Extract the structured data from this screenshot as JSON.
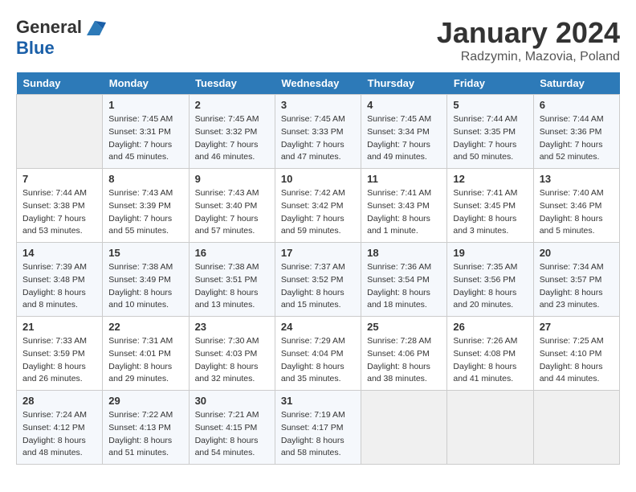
{
  "header": {
    "logo_general": "General",
    "logo_blue": "Blue",
    "month": "January 2024",
    "location": "Radzymin, Mazovia, Poland"
  },
  "weekdays": [
    "Sunday",
    "Monday",
    "Tuesday",
    "Wednesday",
    "Thursday",
    "Friday",
    "Saturday"
  ],
  "weeks": [
    [
      {
        "day": "",
        "sunrise": "",
        "sunset": "",
        "daylight": ""
      },
      {
        "day": "1",
        "sunrise": "Sunrise: 7:45 AM",
        "sunset": "Sunset: 3:31 PM",
        "daylight": "Daylight: 7 hours and 45 minutes."
      },
      {
        "day": "2",
        "sunrise": "Sunrise: 7:45 AM",
        "sunset": "Sunset: 3:32 PM",
        "daylight": "Daylight: 7 hours and 46 minutes."
      },
      {
        "day": "3",
        "sunrise": "Sunrise: 7:45 AM",
        "sunset": "Sunset: 3:33 PM",
        "daylight": "Daylight: 7 hours and 47 minutes."
      },
      {
        "day": "4",
        "sunrise": "Sunrise: 7:45 AM",
        "sunset": "Sunset: 3:34 PM",
        "daylight": "Daylight: 7 hours and 49 minutes."
      },
      {
        "day": "5",
        "sunrise": "Sunrise: 7:44 AM",
        "sunset": "Sunset: 3:35 PM",
        "daylight": "Daylight: 7 hours and 50 minutes."
      },
      {
        "day": "6",
        "sunrise": "Sunrise: 7:44 AM",
        "sunset": "Sunset: 3:36 PM",
        "daylight": "Daylight: 7 hours and 52 minutes."
      }
    ],
    [
      {
        "day": "7",
        "sunrise": "Sunrise: 7:44 AM",
        "sunset": "Sunset: 3:38 PM",
        "daylight": "Daylight: 7 hours and 53 minutes."
      },
      {
        "day": "8",
        "sunrise": "Sunrise: 7:43 AM",
        "sunset": "Sunset: 3:39 PM",
        "daylight": "Daylight: 7 hours and 55 minutes."
      },
      {
        "day": "9",
        "sunrise": "Sunrise: 7:43 AM",
        "sunset": "Sunset: 3:40 PM",
        "daylight": "Daylight: 7 hours and 57 minutes."
      },
      {
        "day": "10",
        "sunrise": "Sunrise: 7:42 AM",
        "sunset": "Sunset: 3:42 PM",
        "daylight": "Daylight: 7 hours and 59 minutes."
      },
      {
        "day": "11",
        "sunrise": "Sunrise: 7:41 AM",
        "sunset": "Sunset: 3:43 PM",
        "daylight": "Daylight: 8 hours and 1 minute."
      },
      {
        "day": "12",
        "sunrise": "Sunrise: 7:41 AM",
        "sunset": "Sunset: 3:45 PM",
        "daylight": "Daylight: 8 hours and 3 minutes."
      },
      {
        "day": "13",
        "sunrise": "Sunrise: 7:40 AM",
        "sunset": "Sunset: 3:46 PM",
        "daylight": "Daylight: 8 hours and 5 minutes."
      }
    ],
    [
      {
        "day": "14",
        "sunrise": "Sunrise: 7:39 AM",
        "sunset": "Sunset: 3:48 PM",
        "daylight": "Daylight: 8 hours and 8 minutes."
      },
      {
        "day": "15",
        "sunrise": "Sunrise: 7:38 AM",
        "sunset": "Sunset: 3:49 PM",
        "daylight": "Daylight: 8 hours and 10 minutes."
      },
      {
        "day": "16",
        "sunrise": "Sunrise: 7:38 AM",
        "sunset": "Sunset: 3:51 PM",
        "daylight": "Daylight: 8 hours and 13 minutes."
      },
      {
        "day": "17",
        "sunrise": "Sunrise: 7:37 AM",
        "sunset": "Sunset: 3:52 PM",
        "daylight": "Daylight: 8 hours and 15 minutes."
      },
      {
        "day": "18",
        "sunrise": "Sunrise: 7:36 AM",
        "sunset": "Sunset: 3:54 PM",
        "daylight": "Daylight: 8 hours and 18 minutes."
      },
      {
        "day": "19",
        "sunrise": "Sunrise: 7:35 AM",
        "sunset": "Sunset: 3:56 PM",
        "daylight": "Daylight: 8 hours and 20 minutes."
      },
      {
        "day": "20",
        "sunrise": "Sunrise: 7:34 AM",
        "sunset": "Sunset: 3:57 PM",
        "daylight": "Daylight: 8 hours and 23 minutes."
      }
    ],
    [
      {
        "day": "21",
        "sunrise": "Sunrise: 7:33 AM",
        "sunset": "Sunset: 3:59 PM",
        "daylight": "Daylight: 8 hours and 26 minutes."
      },
      {
        "day": "22",
        "sunrise": "Sunrise: 7:31 AM",
        "sunset": "Sunset: 4:01 PM",
        "daylight": "Daylight: 8 hours and 29 minutes."
      },
      {
        "day": "23",
        "sunrise": "Sunrise: 7:30 AM",
        "sunset": "Sunset: 4:03 PM",
        "daylight": "Daylight: 8 hours and 32 minutes."
      },
      {
        "day": "24",
        "sunrise": "Sunrise: 7:29 AM",
        "sunset": "Sunset: 4:04 PM",
        "daylight": "Daylight: 8 hours and 35 minutes."
      },
      {
        "day": "25",
        "sunrise": "Sunrise: 7:28 AM",
        "sunset": "Sunset: 4:06 PM",
        "daylight": "Daylight: 8 hours and 38 minutes."
      },
      {
        "day": "26",
        "sunrise": "Sunrise: 7:26 AM",
        "sunset": "Sunset: 4:08 PM",
        "daylight": "Daylight: 8 hours and 41 minutes."
      },
      {
        "day": "27",
        "sunrise": "Sunrise: 7:25 AM",
        "sunset": "Sunset: 4:10 PM",
        "daylight": "Daylight: 8 hours and 44 minutes."
      }
    ],
    [
      {
        "day": "28",
        "sunrise": "Sunrise: 7:24 AM",
        "sunset": "Sunset: 4:12 PM",
        "daylight": "Daylight: 8 hours and 48 minutes."
      },
      {
        "day": "29",
        "sunrise": "Sunrise: 7:22 AM",
        "sunset": "Sunset: 4:13 PM",
        "daylight": "Daylight: 8 hours and 51 minutes."
      },
      {
        "day": "30",
        "sunrise": "Sunrise: 7:21 AM",
        "sunset": "Sunset: 4:15 PM",
        "daylight": "Daylight: 8 hours and 54 minutes."
      },
      {
        "day": "31",
        "sunrise": "Sunrise: 7:19 AM",
        "sunset": "Sunset: 4:17 PM",
        "daylight": "Daylight: 8 hours and 58 minutes."
      },
      {
        "day": "",
        "sunrise": "",
        "sunset": "",
        "daylight": ""
      },
      {
        "day": "",
        "sunrise": "",
        "sunset": "",
        "daylight": ""
      },
      {
        "day": "",
        "sunrise": "",
        "sunset": "",
        "daylight": ""
      }
    ]
  ]
}
